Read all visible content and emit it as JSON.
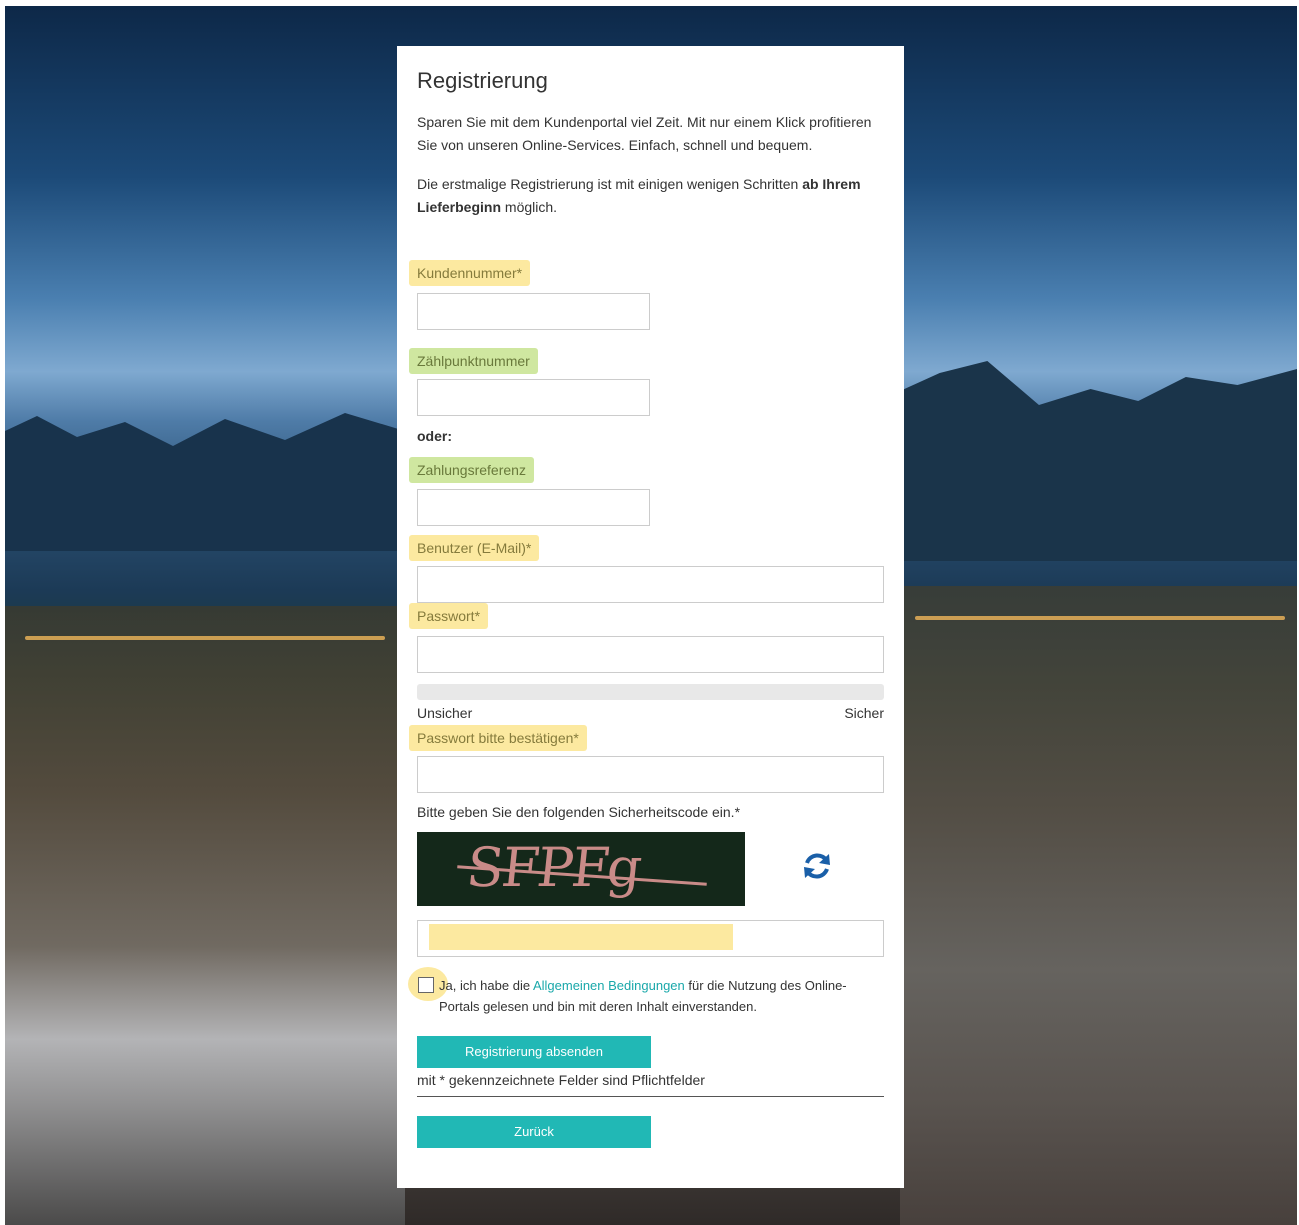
{
  "form": {
    "title": "Registrierung",
    "intro": "Sparen Sie mit dem Kundenportal viel Zeit. Mit nur einem Klick profitieren Sie von unseren Online-Services. Einfach, schnell und bequem.",
    "info_prefix": "Die erstmalige Registrierung ist mit einigen wenigen Schritten ",
    "info_bold": "ab Ihrem Lieferbeginn",
    "info_suffix": " möglich.",
    "fields": {
      "customer_number": {
        "label": "Kundennummer*",
        "value": ""
      },
      "meter_point_number": {
        "label": "Zählpunktnummer",
        "value": ""
      },
      "or_text": "oder:",
      "payment_reference": {
        "label": "Zahlungsreferenz",
        "value": ""
      },
      "user_email": {
        "label": "Benutzer (E-Mail)*",
        "value": ""
      },
      "password": {
        "label": "Passwort*",
        "value": ""
      },
      "password_confirm": {
        "label": "Passwort bitte bestätigen*",
        "value": ""
      }
    },
    "password_strength": {
      "level": 0,
      "weak_label": "Unsicher",
      "strong_label": "Sicher"
    },
    "captcha": {
      "prompt": "Bitte geben Sie den folgenden Sicherheitscode ein.*",
      "image_text": "SFPFg",
      "value": ""
    },
    "terms": {
      "checked": false,
      "prefix": "Ja, ich habe die ",
      "link_text": "Allgemeinen Bedingungen",
      "suffix": " für die Nutzung des Online-Portals gelesen und bin mit deren Inhalt einverstanden."
    },
    "submit_label": "Registrierung absenden",
    "required_note": "mit * gekennzeichnete Felder sind Pflichtfelder",
    "back_label": "Zurück"
  },
  "colors": {
    "accent": "#21b8b5",
    "link": "#1aa8aa",
    "highlight_yellow": "#fce9a0",
    "highlight_green": "#cfe7a0",
    "refresh_icon": "#1a5fa8"
  },
  "icons": {
    "refresh": "refresh-icon",
    "checkbox": "checkbox-icon"
  }
}
